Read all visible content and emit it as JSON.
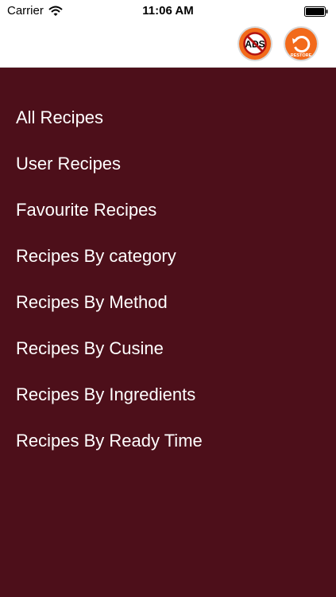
{
  "status_bar": {
    "carrier": "Carrier",
    "time": "11:06 AM",
    "wifi_icon": "wifi-icon",
    "battery_icon": "battery-icon"
  },
  "toolbar": {
    "ads_button": {
      "label": "ADS",
      "icon": "no-ads-icon",
      "color": "#f26a1b"
    },
    "restore_button": {
      "label": "RESTORE",
      "icon": "restore-icon",
      "color": "#f26a1b"
    }
  },
  "menu": {
    "background": "#4d0f1a",
    "items": [
      {
        "label": "All Recipes"
      },
      {
        "label": "User Recipes"
      },
      {
        "label": "Favourite Recipes"
      },
      {
        "label": "Recipes By category"
      },
      {
        "label": "Recipes By Method"
      },
      {
        "label": "Recipes By Cusine"
      },
      {
        "label": "Recipes By Ingredients"
      },
      {
        "label": "Recipes By Ready Time"
      }
    ]
  }
}
